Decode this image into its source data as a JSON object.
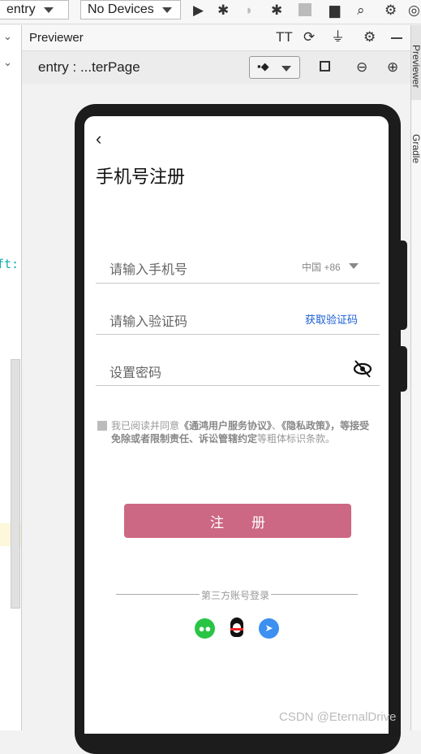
{
  "toolbar": {
    "module": "entry",
    "device": "No Devices",
    "icons": [
      "run-icon",
      "debug-icon",
      "attach-icon",
      "profile-icon",
      "stop-icon",
      "project-structure-icon",
      "search-icon",
      "settings-icon",
      "account-icon"
    ]
  },
  "previewer": {
    "title": "Previewer",
    "icons": [
      "font-size-icon",
      "refresh-icon",
      "plug-icon",
      "settings-icon",
      "minimize-icon"
    ],
    "page": "entry : ...terPage",
    "sub_icons": [
      "layout-icon",
      "dropdown-icon",
      "rotate-icon",
      "zoom-out-icon",
      "zoom-in-icon"
    ]
  },
  "side_tabs": {
    "previewer": "Previewer",
    "gradle": "Gradle"
  },
  "editor": {
    "code_fragment": "ft:"
  },
  "app": {
    "title": "手机号注册",
    "phone_placeholder": "请输入手机号",
    "country_code": "中国 +86",
    "code_placeholder": "请输入验证码",
    "get_code": "获取验证码",
    "password_placeholder": "设置密码",
    "agree": {
      "p1": "我已阅读并同意",
      "b1": "《通鸿用户服务协议》",
      "p2": "、",
      "b2": "《隐私政策》",
      "p3": "，等",
      "b3": "接受免除或者限制责任、诉讼管辖约定",
      "p4": "等粗体标识条款。"
    },
    "register": "注　　册",
    "third_party": "第三方账号登录",
    "social": [
      "wechat-icon",
      "qq-icon",
      "dingtalk-icon"
    ]
  },
  "colors": {
    "accent": "#cc6784",
    "link": "#1a5fd6",
    "wechat": "#2ac445",
    "dingtalk": "#3d8ff0"
  },
  "watermark": "CSDN @EternalDrive"
}
